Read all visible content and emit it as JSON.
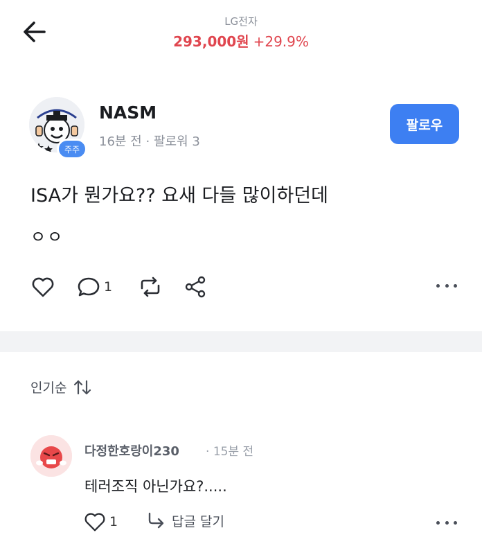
{
  "header": {
    "stock_name": "LG전자",
    "price": "293,000원",
    "change": "+29.9%",
    "price_color": "#e0464f"
  },
  "post": {
    "username": "NASM",
    "badge": "주주",
    "time": "16분 전",
    "followers": "팔로워 3",
    "follow_label": "팔로우",
    "title": "ISA가 뭔가요?? 요새 다들 많이하던데",
    "body": "ㅇㅇ",
    "comment_count": "1",
    "accent": "#3d7ff2"
  },
  "comments_section": {
    "sort_label": "인기순"
  },
  "comment": {
    "username": "다정한호랑이230",
    "time": "15분 전",
    "text": "테러조직 아닌가요?.....",
    "like_count": "1",
    "reply_label": "답글 달기"
  }
}
